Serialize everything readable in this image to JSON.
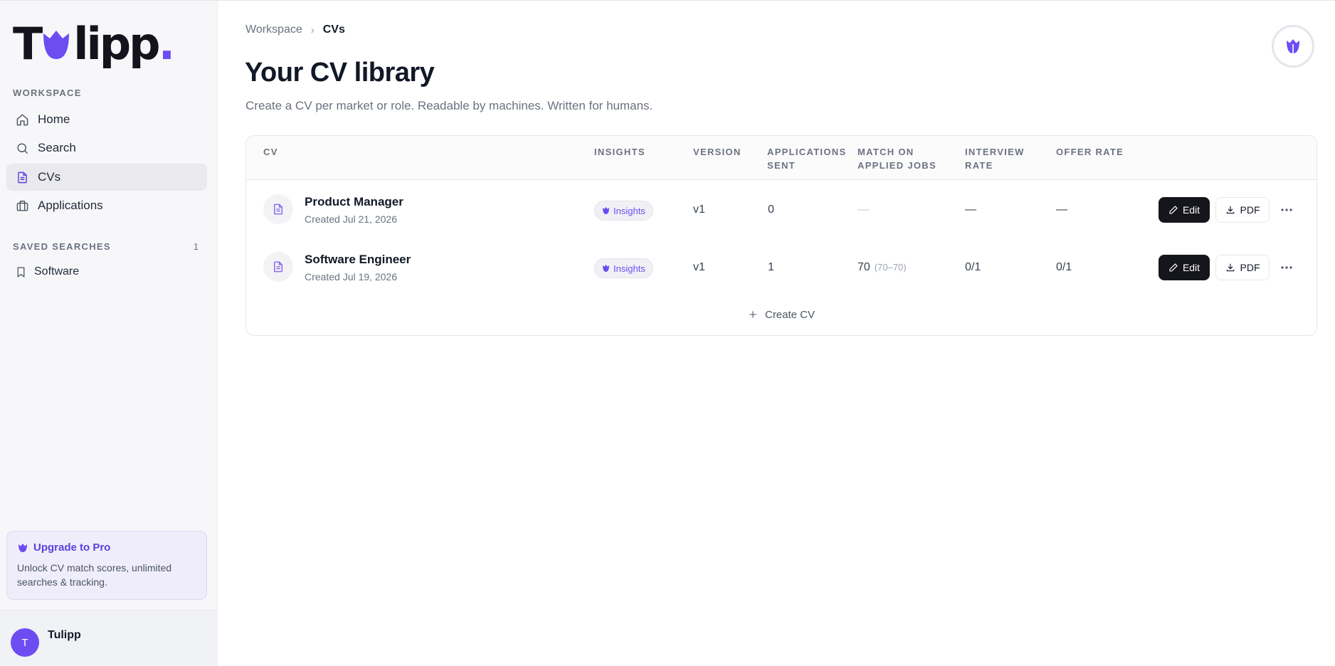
{
  "brand": {
    "name": "Tulipp",
    "logo_text_start": "T",
    "logo_text_end": "lipp",
    "logo_dot": ".",
    "accent_color": "#6d4df2"
  },
  "sidebar": {
    "workspace_label": "WORKSPACE",
    "nav": [
      {
        "label": "Home",
        "icon": "home-icon",
        "active": false
      },
      {
        "label": "Search",
        "icon": "search-icon",
        "active": false
      },
      {
        "label": "CVs",
        "icon": "document-icon",
        "active": true
      },
      {
        "label": "Applications",
        "icon": "briefcase-icon",
        "active": false
      }
    ],
    "saved_searches_label": "SAVED SEARCHES",
    "saved_searches_count": "1",
    "saved_searches": [
      {
        "label": "Software",
        "icon": "bookmark-icon"
      }
    ],
    "upgrade": {
      "title": "Upgrade to Pro",
      "body": "Unlock CV match scores, unlimited searches & tracking."
    },
    "user": {
      "initial": "T",
      "name": "Tulipp"
    }
  },
  "breadcrumb": {
    "parent": "Workspace",
    "current": "CVs"
  },
  "page": {
    "title": "Your CV library",
    "subtitle": "Create a CV per market or role. Readable by machines. Written for humans."
  },
  "table": {
    "columns": {
      "cv": "CV",
      "insights": "INSIGHTS",
      "version": "VERSION",
      "applications_line1": "APPLICATIONS",
      "applications_line2": "SENT",
      "match_line1": "MATCH ON",
      "match_line2": "APPLIED JOBS",
      "interview_line1": "INTERVIEW",
      "interview_line2": "RATE",
      "offer": "OFFER RATE"
    },
    "rows": [
      {
        "title": "Product Manager",
        "created": "Created Jul 21, 2026",
        "insights": "Insights",
        "version": "v1",
        "applications": "0",
        "match": "—",
        "match_range": "",
        "interview": "—",
        "offer": "—",
        "edit": "Edit",
        "pdf": "PDF"
      },
      {
        "title": "Software Engineer",
        "created": "Created Jul 19, 2026",
        "insights": "Insights",
        "version": "v1",
        "applications": "1",
        "match": "70",
        "match_range": "(70–70)",
        "interview": "0/1",
        "offer": "0/1",
        "edit": "Edit",
        "pdf": "PDF"
      }
    ],
    "create_label": "Create CV"
  }
}
